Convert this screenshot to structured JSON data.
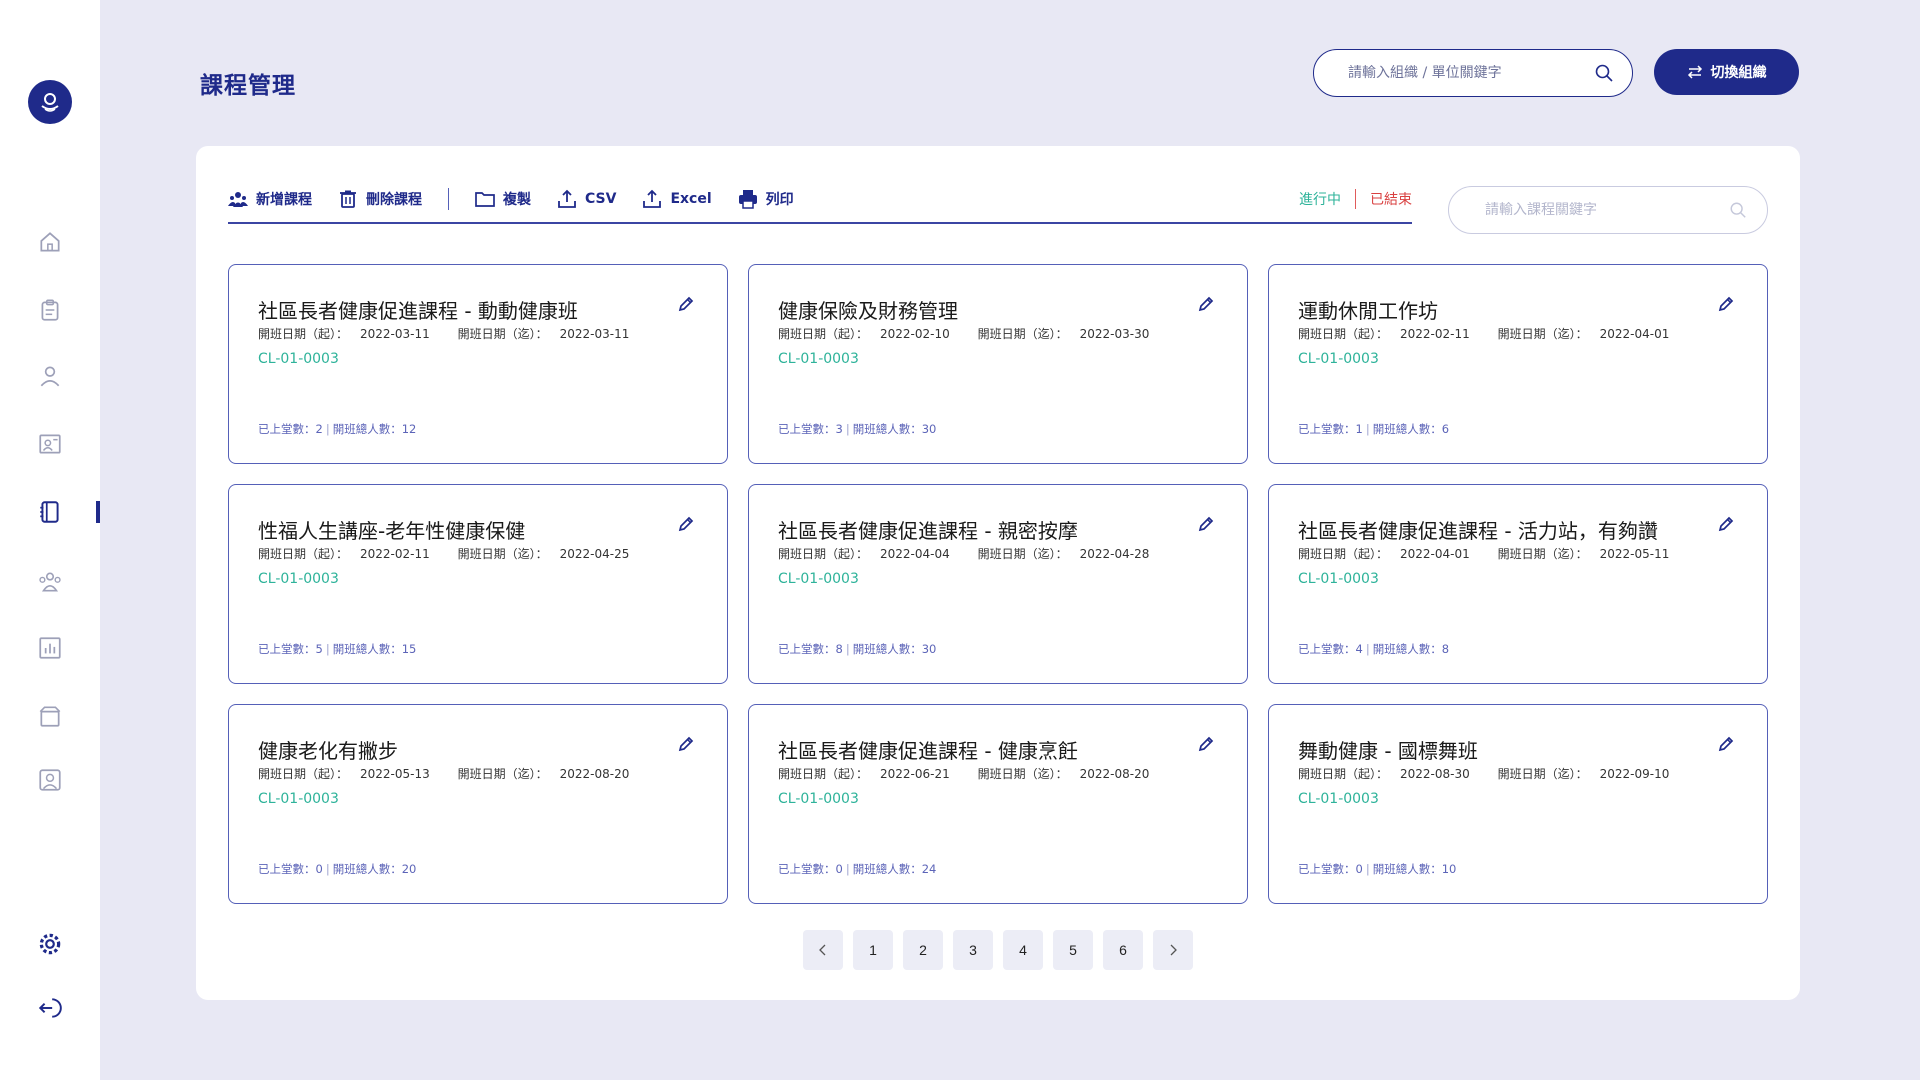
{
  "header": {
    "title": "課程管理",
    "org_search_placeholder": "請輸入組織 / 單位關鍵字",
    "switch_label": "切換組織"
  },
  "sidebar": {
    "items": [
      {
        "icon": "home-icon"
      },
      {
        "icon": "clipboard-icon"
      },
      {
        "icon": "user-icon"
      },
      {
        "icon": "classroom-icon"
      },
      {
        "icon": "notebook-icon",
        "active": true
      },
      {
        "icon": "group-icon"
      },
      {
        "icon": "chart-icon"
      },
      {
        "icon": "box-icon"
      },
      {
        "icon": "profile-card-icon"
      }
    ],
    "bottom": [
      {
        "icon": "settings-icon"
      },
      {
        "icon": "logout-icon"
      }
    ]
  },
  "toolbar": {
    "add": "新增課程",
    "delete": "刪除課程",
    "copy": "複製",
    "csv": "CSV",
    "excel": "Excel",
    "print": "列印"
  },
  "status": {
    "ongoing": "進行中",
    "ended": "已結束"
  },
  "course_search_placeholder": "請輸入課程關鍵字",
  "date_start_label": "開班日期（起）：",
  "date_end_label": "開班日期（迄）：",
  "stats_sessions_label": "已上堂數：",
  "stats_total_label": "開班總人數：",
  "courses": [
    {
      "title": "社區長者健康促進課程 - 動動健康班",
      "start": "2022-03-11",
      "end": "2022-03-11",
      "code": "CL-01-0003",
      "sessions": "2",
      "total": "12"
    },
    {
      "title": "健康保險及財務管理",
      "start": "2022-02-10",
      "end": "2022-03-30",
      "code": "CL-01-0003",
      "sessions": "3",
      "total": "30"
    },
    {
      "title": "運動休閒工作坊",
      "start": "2022-02-11",
      "end": "2022-04-01",
      "code": "CL-01-0003",
      "sessions": "1",
      "total": "6"
    },
    {
      "title": "性福人生講座-老年性健康保健",
      "start": "2022-02-11",
      "end": "2022-04-25",
      "code": "CL-01-0003",
      "sessions": "5",
      "total": "15"
    },
    {
      "title": "社區長者健康促進課程 - 親密按摩",
      "start": "2022-04-04",
      "end": "2022-04-28",
      "code": "CL-01-0003",
      "sessions": "8",
      "total": "30"
    },
    {
      "title": "社區長者健康促進課程 - 活力站，有夠讚",
      "start": "2022-04-01",
      "end": "2022-05-11",
      "code": "CL-01-0003",
      "sessions": "4",
      "total": "8"
    },
    {
      "title": "健康老化有撇步",
      "start": "2022-05-13",
      "end": "2022-08-20",
      "code": "CL-01-0003",
      "sessions": "0",
      "total": "20"
    },
    {
      "title": "社區長者健康促進課程 - 健康烹飪",
      "start": "2022-06-21",
      "end": "2022-08-20",
      "code": "CL-01-0003",
      "sessions": "0",
      "total": "24"
    },
    {
      "title": "舞動健康 - 國標舞班",
      "start": "2022-08-30",
      "end": "2022-09-10",
      "code": "CL-01-0003",
      "sessions": "0",
      "total": "10"
    }
  ],
  "pagination": {
    "pages": [
      "1",
      "2",
      "3",
      "4",
      "5",
      "6"
    ]
  },
  "colors": {
    "primary": "#1F2A8A",
    "accent_green": "#2EB39A",
    "accent_red": "#D94141",
    "background": "#E8E8F4"
  }
}
